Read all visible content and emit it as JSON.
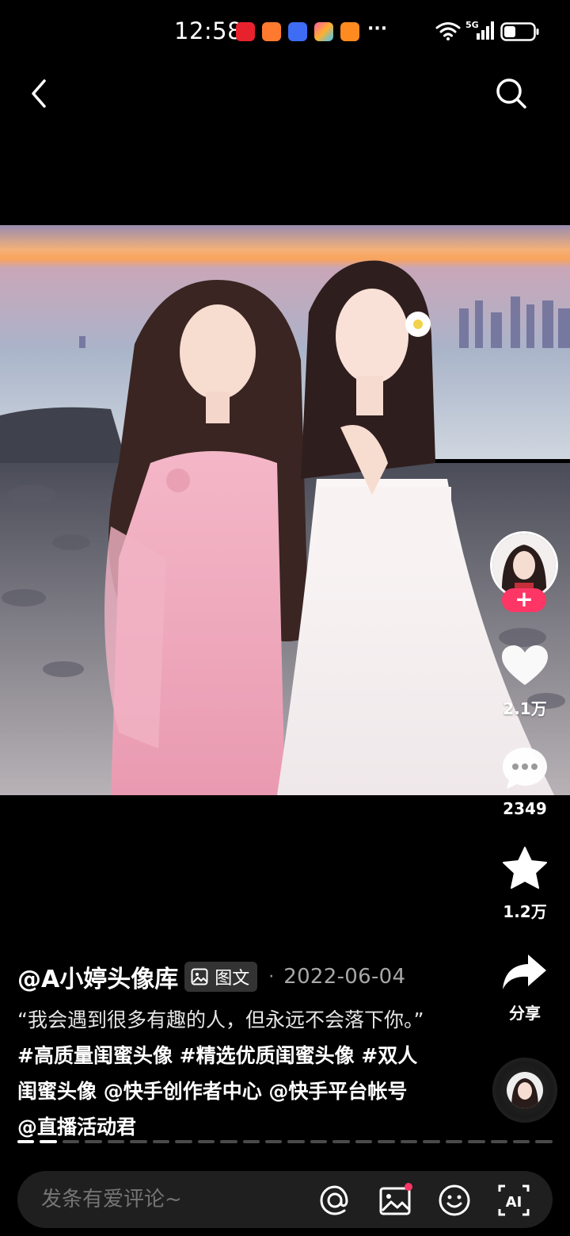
{
  "status_bar": {
    "time": "12:58",
    "extra": "···",
    "network": "5G",
    "app_icon_colors": [
      "#e8222d",
      "#ff7a2e",
      "#3e6cf5",
      "#f85aa0",
      "#ff8a1f"
    ]
  },
  "nav": {
    "back_icon": "chevron-left-icon",
    "search_icon": "search-icon"
  },
  "post": {
    "author": "@A小婷头像库",
    "type_badge": "图文",
    "separator": "·",
    "date": "2022-06-04",
    "caption_quote": "“我会遇到很多有趣的人，但永远不会落下你。”",
    "caption_tags": "#高质量闺蜜头像 #精选优质闺蜜头像 #双人闺蜜头像 @快手创作者中心 @快手平台帐号 @直播活动君"
  },
  "actions": {
    "follow_label": "+",
    "like_count": "2.1万",
    "comment_count": "2349",
    "favorite_count": "1.2万",
    "share_label": "分享"
  },
  "page_indicator": {
    "total": 24,
    "current": 2
  },
  "comment_bar": {
    "placeholder": "发条有爱评论~",
    "icons": [
      "at-mention-icon",
      "image-picker-icon",
      "emoji-icon",
      "ai-icon"
    ],
    "notification_dot_color": "#fe3666"
  }
}
